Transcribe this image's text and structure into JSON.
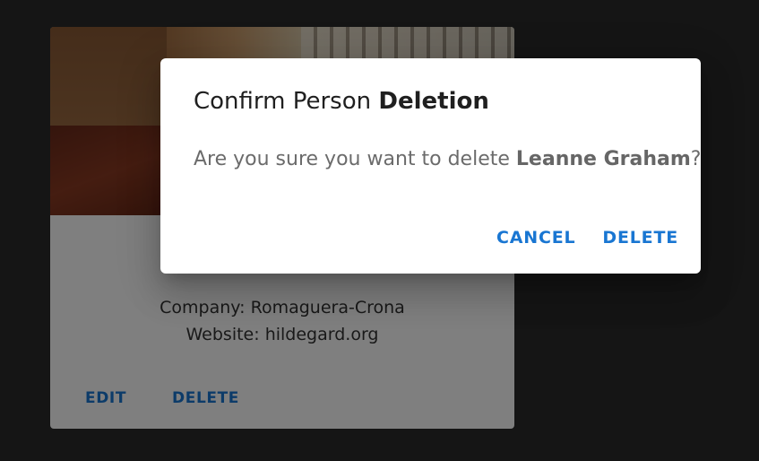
{
  "card": {
    "company_label": "Company:",
    "company_value": "Romaguera-Crona",
    "website_label": "Website:",
    "website_value": "hildegard.org",
    "edit_label": "EDIT",
    "delete_label": "DELETE"
  },
  "dialog": {
    "title_prefix": "Confirm Person",
    "title_emphasis": "Deletion",
    "message_prefix": "Are you sure you want to delete",
    "message_name": "Leanne Graham",
    "message_suffix": "?",
    "cancel_label": "CANCEL",
    "delete_label": "DELETE"
  },
  "colors": {
    "accent": "#1976d2",
    "backdrop": "rgba(0,0,0,0.5)",
    "page_background": "#141414"
  }
}
